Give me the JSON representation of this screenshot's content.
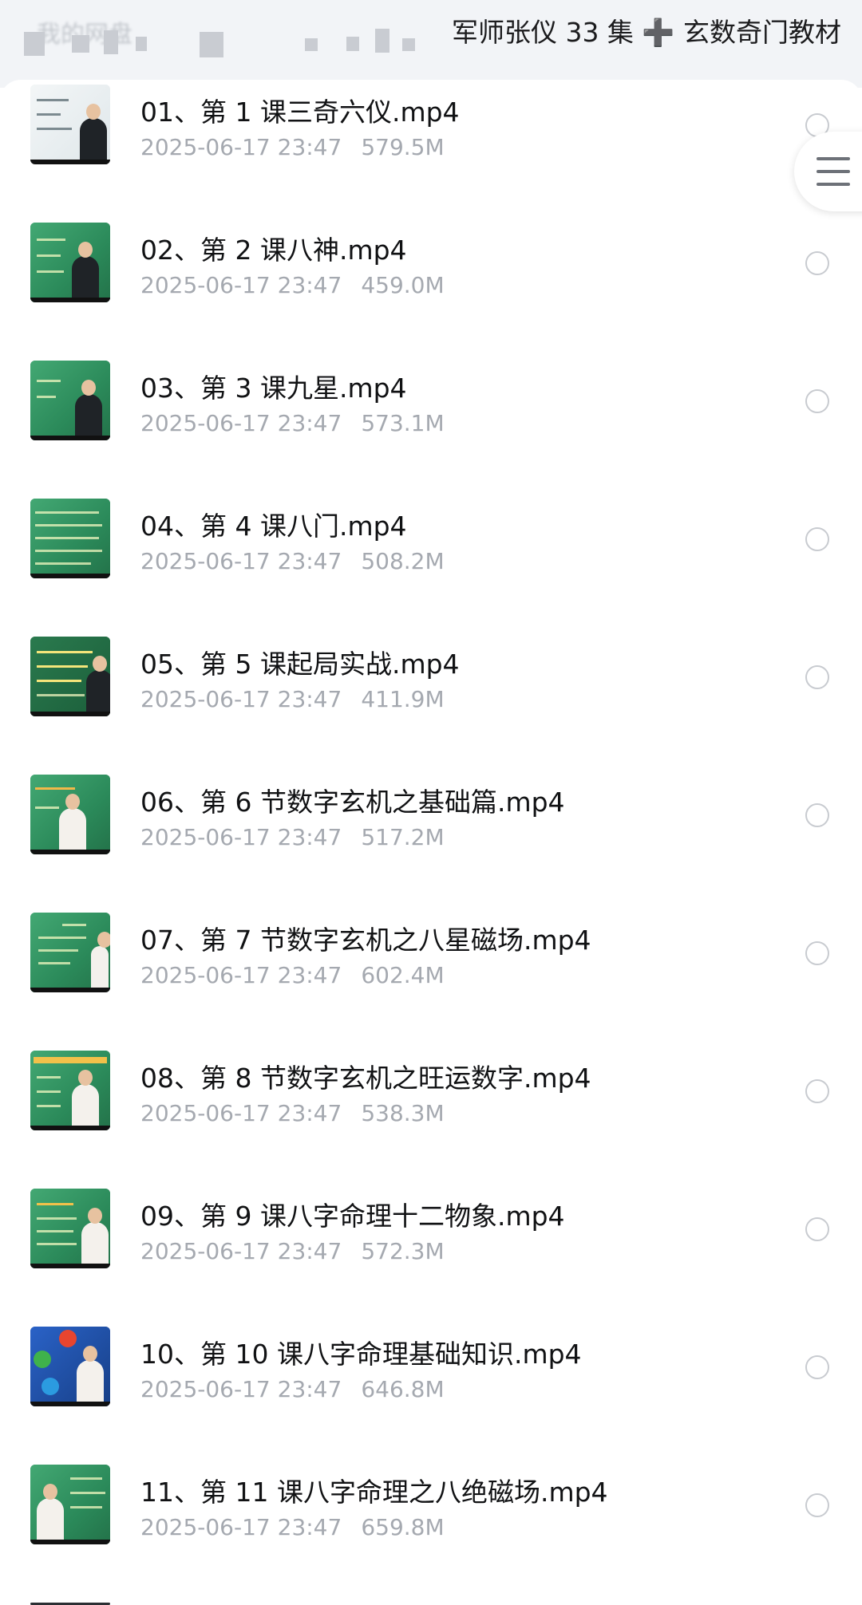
{
  "header": {
    "breadcrumb": "我的网盘",
    "title": "军师张仪 33 集 ➕ 玄数奇门教材"
  },
  "files": [
    {
      "name": "01、第 1 课三奇六仪.mp4",
      "date": "2025-06-17 23:47",
      "size": "579.5M"
    },
    {
      "name": "02、第 2 课八神.mp4",
      "date": "2025-06-17 23:47",
      "size": "459.0M"
    },
    {
      "name": "03、第 3 课九星.mp4",
      "date": "2025-06-17 23:47",
      "size": "573.1M"
    },
    {
      "name": "04、第 4 课八门.mp4",
      "date": "2025-06-17 23:47",
      "size": "508.2M"
    },
    {
      "name": "05、第 5 课起局实战.mp4",
      "date": "2025-06-17 23:47",
      "size": "411.9M"
    },
    {
      "name": "06、第 6 节数字玄机之基础篇.mp4",
      "date": "2025-06-17 23:47",
      "size": "517.2M"
    },
    {
      "name": "07、第 7 节数字玄机之八星磁场.mp4",
      "date": "2025-06-17 23:47",
      "size": "602.4M"
    },
    {
      "name": "08、第 8 节数字玄机之旺运数字.mp4",
      "date": "2025-06-17 23:47",
      "size": "538.3M"
    },
    {
      "name": "09、第 9 课八字命理十二物象.mp4",
      "date": "2025-06-17 23:47",
      "size": "572.3M"
    },
    {
      "name": "10、第 10 课八字命理基础知识.mp4",
      "date": "2025-06-17 23:47",
      "size": "646.8M"
    },
    {
      "name": "11、第 11 课八字命理之八绝磁场.mp4",
      "date": "2025-06-17 23:47",
      "size": "659.8M"
    }
  ],
  "icons": {
    "menu": "hamburger-menu-icon",
    "select": "radio-circle-icon"
  },
  "colors": {
    "title_text": "#111214",
    "meta_text": "#a5a9b0",
    "thumb_board": "#2b8a5a"
  }
}
